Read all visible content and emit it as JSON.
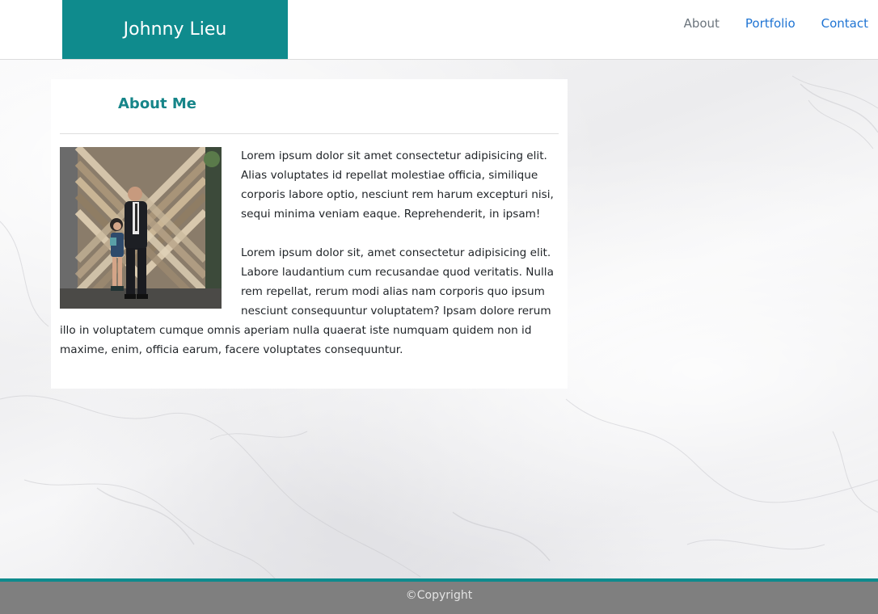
{
  "navbar": {
    "brand": "Johnny Lieu",
    "links": [
      {
        "label": "About"
      },
      {
        "label": "Portfolio"
      },
      {
        "label": "Contact"
      }
    ]
  },
  "about": {
    "title": "About Me",
    "paragraphs": [
      "Lorem ipsum dolor sit amet consectetur adipisicing elit. Alias voluptates id repellat molestiae officia, similique corporis labore optio, nesciunt rem harum excepturi nisi, sequi minima veniam eaque. Reprehenderit, in ipsam!",
      "Lorem ipsum dolor sit, amet consectetur adipisicing elit. Labore laudantium cum recusandae quod veritatis. Nulla rem repellat, rerum modi alias nam corporis quo ipsum nesciunt consequuntur voluptatem? Ipsam dolore rerum illo in voluptatem cumque omnis aperiam nulla quaerat iste numquam quidem non id maxime, enim, officia earum, facere voluptates consequuntur."
    ]
  },
  "footer": {
    "copyright": "©Copyright"
  },
  "colors": {
    "accent": "#0f8b8d",
    "title": "#168589",
    "link": "#1f74d3",
    "footer_bg": "#7f7f7f"
  }
}
